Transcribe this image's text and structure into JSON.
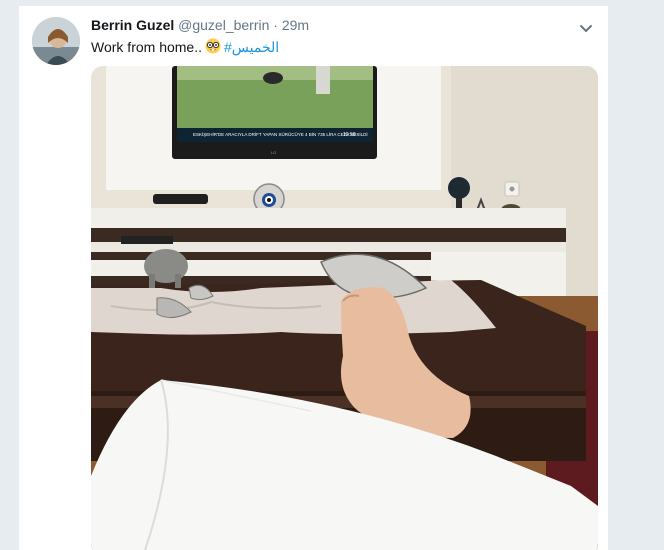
{
  "tweet": {
    "author_name": "Berrin Guzel",
    "handle": "@guzel_berrin",
    "separator": "·",
    "time": "29m",
    "text": "Work from home..",
    "hashtag": "#الخميس",
    "emoji": "nerd-face-emoji"
  },
  "photo": {
    "tv_ticker": "ESKİŞEHİR'DE ARACIYLA DRİFT YAPAN SÜRÜCÜYE 4 BİN 735 LİRA CEZA KESİLDİ",
    "tv_clock": "10:50",
    "tv_brand": "LG"
  },
  "icons": {
    "caret": "chevron-down-icon"
  },
  "colors": {
    "link": "#1b95e0",
    "text": "#14171a",
    "muted": "#657786",
    "background": "#e6ecf0"
  }
}
